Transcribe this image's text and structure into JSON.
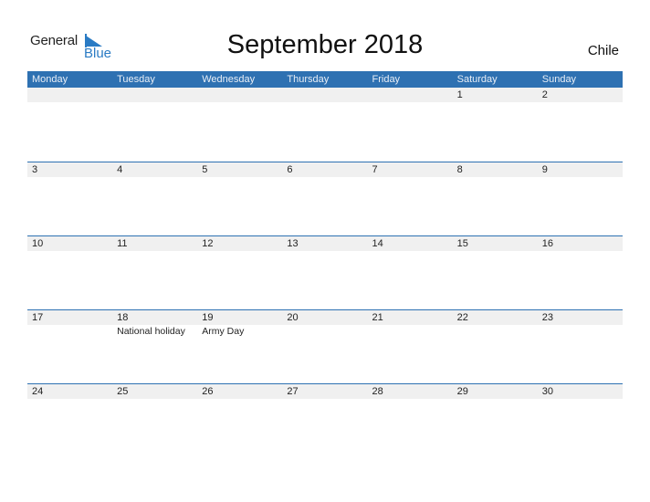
{
  "logo": {
    "line1": "General",
    "line2": "Blue"
  },
  "title": "September 2018",
  "country": "Chile",
  "colors": {
    "header_bg": "#2e71b2",
    "row_bg": "#f0f0f0",
    "brand_blue": "#2a7bc4"
  },
  "weekdays": [
    "Monday",
    "Tuesday",
    "Wednesday",
    "Thursday",
    "Friday",
    "Saturday",
    "Sunday"
  ],
  "weeks": [
    {
      "days": [
        "",
        "",
        "",
        "",
        "",
        "1",
        "2"
      ],
      "events": [
        "",
        "",
        "",
        "",
        "",
        "",
        ""
      ]
    },
    {
      "days": [
        "3",
        "4",
        "5",
        "6",
        "7",
        "8",
        "9"
      ],
      "events": [
        "",
        "",
        "",
        "",
        "",
        "",
        ""
      ]
    },
    {
      "days": [
        "10",
        "11",
        "12",
        "13",
        "14",
        "15",
        "16"
      ],
      "events": [
        "",
        "",
        "",
        "",
        "",
        "",
        ""
      ]
    },
    {
      "days": [
        "17",
        "18",
        "19",
        "20",
        "21",
        "22",
        "23"
      ],
      "events": [
        "",
        "National holiday",
        "Army Day",
        "",
        "",
        "",
        ""
      ]
    },
    {
      "days": [
        "24",
        "25",
        "26",
        "27",
        "28",
        "29",
        "30"
      ],
      "events": [
        "",
        "",
        "",
        "",
        "",
        "",
        ""
      ]
    }
  ]
}
